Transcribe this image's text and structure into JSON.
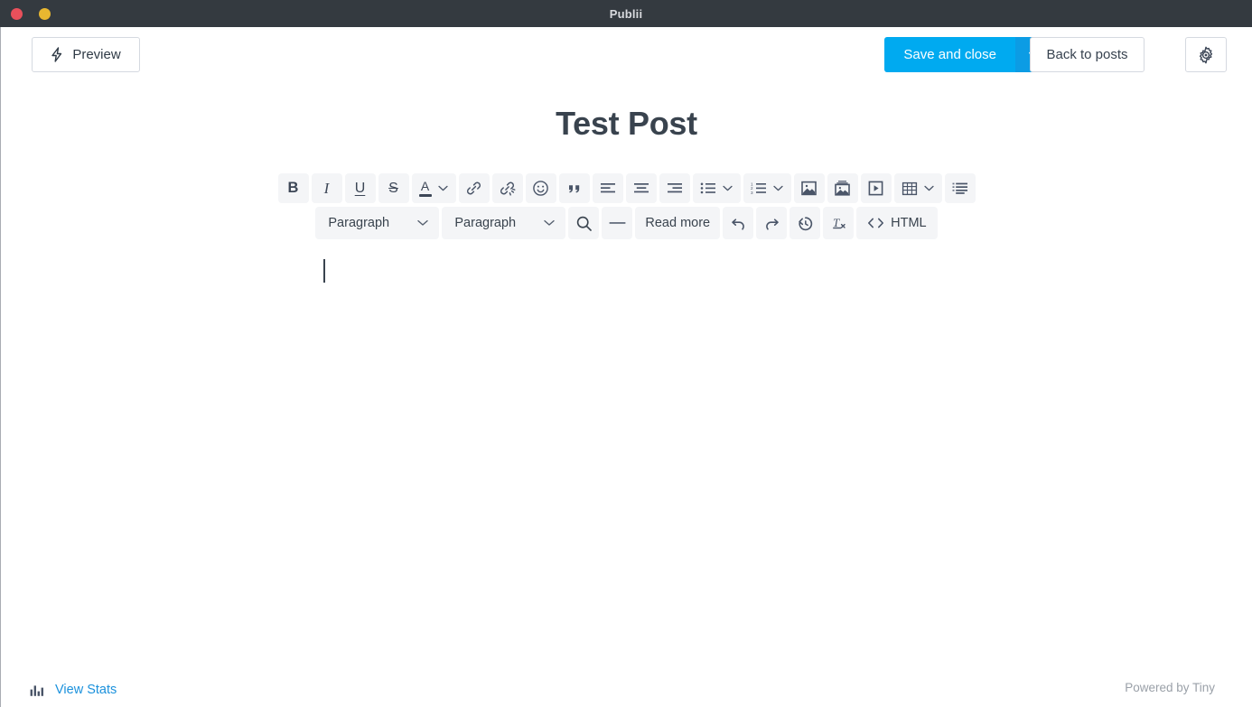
{
  "window": {
    "title": "Publii",
    "controls": [
      {
        "name": "close",
        "color": "#e8505b"
      },
      {
        "name": "minimize",
        "color": "#e8b730"
      }
    ]
  },
  "topbar": {
    "preview_label": "Preview",
    "preview_icon": "lightning-bolt-icon",
    "save_label": "Save and close",
    "save_caret_icon": "chevron-down-icon",
    "back_label": "Back to posts",
    "settings_icon": "gear-icon",
    "accent_color": "#00aaf0",
    "accent_dark_color": "#0c9ce4"
  },
  "post": {
    "title": "Test Post",
    "body": ""
  },
  "toolbar": {
    "row1": [
      {
        "name": "bold-button",
        "icon": "bold-icon",
        "label": "B"
      },
      {
        "name": "italic-button",
        "icon": "italic-icon",
        "label": "I"
      },
      {
        "name": "underline-button",
        "icon": "underline-icon",
        "label": "U"
      },
      {
        "name": "strikethrough-button",
        "icon": "strikethrough-icon",
        "label": "S"
      },
      {
        "name": "text-color-button",
        "icon": "text-color-icon",
        "label": "A"
      },
      {
        "name": "link-button",
        "icon": "link-icon"
      },
      {
        "name": "unlink-button",
        "icon": "unlink-icon"
      },
      {
        "name": "emoji-button",
        "icon": "emoji-icon"
      },
      {
        "name": "blockquote-button",
        "icon": "quote-icon"
      },
      {
        "name": "align-left-button",
        "icon": "align-left-icon"
      },
      {
        "name": "align-center-button",
        "icon": "align-center-icon"
      },
      {
        "name": "align-right-button",
        "icon": "align-right-icon"
      },
      {
        "name": "bullet-list-button",
        "icon": "bullet-list-icon"
      },
      {
        "name": "numbered-list-button",
        "icon": "numbered-list-icon"
      },
      {
        "name": "insert-image-button",
        "icon": "image-icon"
      },
      {
        "name": "insert-gallery-button",
        "icon": "gallery-icon"
      },
      {
        "name": "insert-video-button",
        "icon": "video-icon"
      },
      {
        "name": "insert-table-button",
        "icon": "table-icon"
      },
      {
        "name": "toc-button",
        "icon": "toc-icon"
      }
    ],
    "row2": {
      "block_format": "Paragraph",
      "block_format2": "Paragraph",
      "search_icon": "search-icon",
      "hr_icon": "horizontal-rule-icon",
      "read_more_label": "Read more",
      "undo_icon": "undo-icon",
      "redo_icon": "redo-icon",
      "restore_icon": "restore-draft-icon",
      "clear_format_icon": "clear-formatting-icon",
      "html_label": "HTML",
      "html_icon": "code-brackets-icon"
    }
  },
  "footer": {
    "view_stats_label": "View Stats",
    "view_stats_icon": "bar-chart-icon",
    "view_stats_color": "#1b91dc",
    "powered_by": "Powered by Tiny"
  }
}
